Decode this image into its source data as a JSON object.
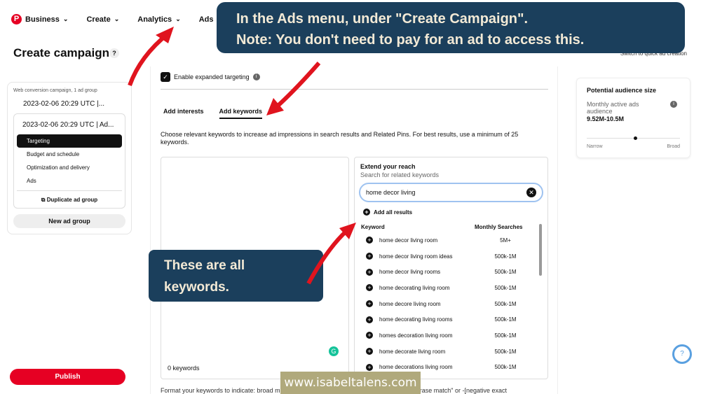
{
  "nav": {
    "items": [
      "Business",
      "Create",
      "Analytics",
      "Ads"
    ]
  },
  "page": {
    "title": "Create campaign",
    "help": "?",
    "switch_link": "Switch to quick ad creation"
  },
  "sidebar": {
    "campaign_subtitle": "Web conversion campaign, 1 ad group",
    "campaign_name": "2023-02-06 20:29 UTC |...",
    "ad_group_name": "2023-02-06 20:29 UTC | Ad...",
    "items": [
      "Targeting",
      "Budget and schedule",
      "Optimization and delivery",
      "Ads"
    ],
    "duplicate": "Duplicate ad group",
    "new_group": "New ad group",
    "publish": "Publish"
  },
  "main": {
    "expanded_targeting": "Enable expanded targeting",
    "tabs": [
      "Add interests",
      "Add keywords"
    ],
    "description": "Choose relevant keywords to increase ad impressions in search results and Related Pins. For best results, use a minimum of 25 keywords.",
    "keyword_count": "0 keywords",
    "format_note": "Format your keywords to indicate: broad match, \"phrase match\", [exact match], -\"negative phrase match\" or -[negative exact"
  },
  "extend": {
    "title": "Extend your reach",
    "subtitle": "Search for related keywords",
    "search_value": "home decor living",
    "add_all": "Add all results",
    "col_keyword": "Keyword",
    "col_searches": "Monthly Searches",
    "rows": [
      {
        "k": "home decor living room",
        "m": "5M+"
      },
      {
        "k": "home decor living room ideas",
        "m": "500k-1M"
      },
      {
        "k": "home decor living rooms",
        "m": "500k-1M"
      },
      {
        "k": "home decorating living room",
        "m": "500k-1M"
      },
      {
        "k": "home decore living room",
        "m": "500k-1M"
      },
      {
        "k": "home decorating living rooms",
        "m": "500k-1M"
      },
      {
        "k": "homes decoration living room",
        "m": "500k-1M"
      },
      {
        "k": "home decorate living room",
        "m": "500k-1M"
      },
      {
        "k": "home decorations living room",
        "m": "500k-1M"
      }
    ]
  },
  "audience": {
    "title": "Potential audience size",
    "label": "Monthly active ads audience",
    "value": "9.52M-10.5M",
    "narrow": "Narrow",
    "broad": "Broad",
    "slider_level": 0.5
  },
  "overlay": {
    "line1": "In the Ads menu, under \"Create Campaign\".",
    "line2": "Note:  You don't need to pay for an ad to access this.",
    "note2_l1": "These are all",
    "note2_l2": "keywords.",
    "watermark": "www.isabeltalens.com"
  }
}
